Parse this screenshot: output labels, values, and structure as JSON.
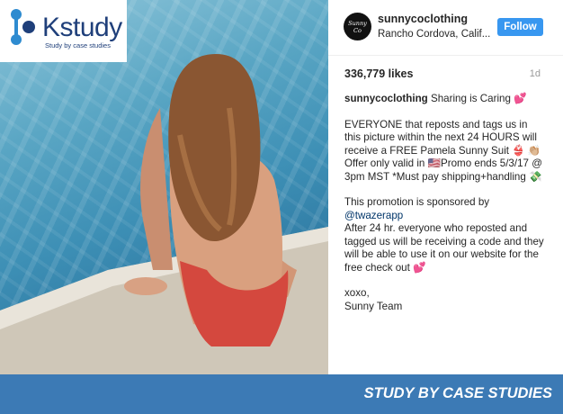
{
  "brand": {
    "name": "Kstudy",
    "tagline": "Study by case studies",
    "banner": "STUDY BY CASE STUDIES",
    "color": "#1f3f7a",
    "banner_color": "#3c7ab5"
  },
  "post": {
    "avatar_text": "Sunny Co",
    "username": "sunnycoclothing",
    "location": "Rancho Cordova, Calif...",
    "follow_label": "Follow",
    "likes": "336,779 likes",
    "age": "1d",
    "caption": {
      "author": "sunnycoclothing",
      "headline": "Sharing is Caring 💕",
      "paragraph1": "EVERYONE that reposts and tags us in this picture within the next 24 HOURS will receive a FREE Pamela Sunny Suit 👙 👏🏼Offer only valid in 🇺🇸Promo ends 5/3/17 @ 3pm MST *Must pay shipping+handling 💸",
      "sponsor_prefix": "This promotion is sponsored by",
      "sponsor_mention": "@twazerapp",
      "paragraph2": "After 24 hr. everyone who reposted and tagged us will be receiving a code and they will be able to use it on our website for the free check out 💕",
      "signoff": "xoxo,",
      "signature": "Sunny Team"
    },
    "follow_color": "#3897f0"
  }
}
